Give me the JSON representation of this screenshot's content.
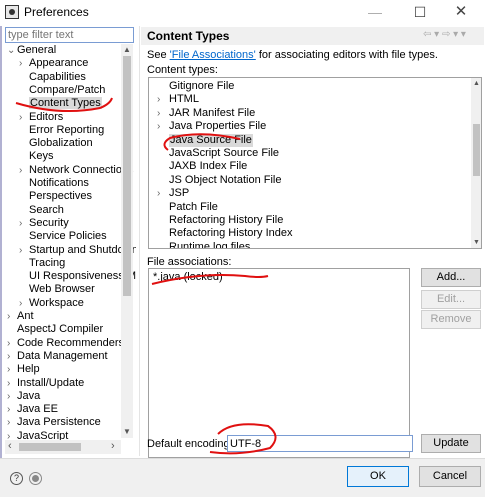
{
  "window": {
    "title": "Preferences",
    "minimize": "—",
    "maximize": "☐",
    "close": "✕"
  },
  "filter": {
    "placeholder": "type filter text"
  },
  "tree": [
    {
      "label": "General",
      "arrow": "⌄",
      "indent": 0
    },
    {
      "label": "Appearance",
      "arrow": "›",
      "indent": 1
    },
    {
      "label": "Capabilities",
      "arrow": "",
      "indent": 1
    },
    {
      "label": "Compare/Patch",
      "arrow": "",
      "indent": 1
    },
    {
      "label": "Content Types",
      "arrow": "",
      "indent": 1,
      "selected": true
    },
    {
      "label": "Editors",
      "arrow": "›",
      "indent": 1
    },
    {
      "label": "Error Reporting",
      "arrow": "",
      "indent": 1
    },
    {
      "label": "Globalization",
      "arrow": "",
      "indent": 1
    },
    {
      "label": "Keys",
      "arrow": "",
      "indent": 1
    },
    {
      "label": "Network Connections",
      "arrow": "›",
      "indent": 1
    },
    {
      "label": "Notifications",
      "arrow": "",
      "indent": 1
    },
    {
      "label": "Perspectives",
      "arrow": "",
      "indent": 1
    },
    {
      "label": "Search",
      "arrow": "",
      "indent": 1
    },
    {
      "label": "Security",
      "arrow": "›",
      "indent": 1
    },
    {
      "label": "Service Policies",
      "arrow": "",
      "indent": 1
    },
    {
      "label": "Startup and Shutdown",
      "arrow": "›",
      "indent": 1
    },
    {
      "label": "Tracing",
      "arrow": "",
      "indent": 1
    },
    {
      "label": "UI Responsiveness M",
      "arrow": "",
      "indent": 1
    },
    {
      "label": "Web Browser",
      "arrow": "",
      "indent": 1
    },
    {
      "label": "Workspace",
      "arrow": "›",
      "indent": 1
    },
    {
      "label": "Ant",
      "arrow": "›",
      "indent": 0
    },
    {
      "label": "AspectJ Compiler",
      "arrow": "",
      "indent": 0
    },
    {
      "label": "Code Recommenders",
      "arrow": "›",
      "indent": 0
    },
    {
      "label": "Data Management",
      "arrow": "›",
      "indent": 0
    },
    {
      "label": "Help",
      "arrow": "›",
      "indent": 0
    },
    {
      "label": "Install/Update",
      "arrow": "›",
      "indent": 0
    },
    {
      "label": "Java",
      "arrow": "›",
      "indent": 0
    },
    {
      "label": "Java EE",
      "arrow": "›",
      "indent": 0
    },
    {
      "label": "Java Persistence",
      "arrow": "›",
      "indent": 0
    },
    {
      "label": "JavaScript",
      "arrow": "›",
      "indent": 0
    }
  ],
  "page": {
    "title": "Content Types",
    "nav_arrows": "⇦ ▾ ⇨ ▾ ▾",
    "desc_before": "See ",
    "desc_link": "'File Associations'",
    "desc_after": " for associating editors with file types.",
    "content_types_label": "Content types:",
    "content_types": [
      {
        "label": "Gitignore File",
        "arrow": ""
      },
      {
        "label": "HTML",
        "arrow": "›"
      },
      {
        "label": "JAR Manifest File",
        "arrow": "›"
      },
      {
        "label": "Java Properties File",
        "arrow": "›"
      },
      {
        "label": "Java Source File",
        "arrow": "",
        "selected": true
      },
      {
        "label": "JavaScript Source File",
        "arrow": ""
      },
      {
        "label": "JAXB Index File",
        "arrow": ""
      },
      {
        "label": "JS Object Notation File",
        "arrow": ""
      },
      {
        "label": "JSP",
        "arrow": "›"
      },
      {
        "label": "Patch File",
        "arrow": ""
      },
      {
        "label": "Refactoring History File",
        "arrow": ""
      },
      {
        "label": "Refactoring History Index",
        "arrow": ""
      },
      {
        "label": "Runtime log files",
        "arrow": ""
      }
    ],
    "file_assoc_label": "File associations:",
    "file_associations": [
      "*.java (locked)"
    ],
    "add_label": "Add...",
    "edit_label": "Edit...",
    "remove_label": "Remove",
    "encoding_label": "Default encoding:",
    "encoding_value": "UTF-8",
    "update_label": "Update"
  },
  "footer": {
    "help": "?",
    "ok_label": "OK",
    "cancel_label": "Cancel"
  },
  "colors": {
    "annotation": "#e01010",
    "link": "#0066cc",
    "selection": "#d9d9d9"
  }
}
